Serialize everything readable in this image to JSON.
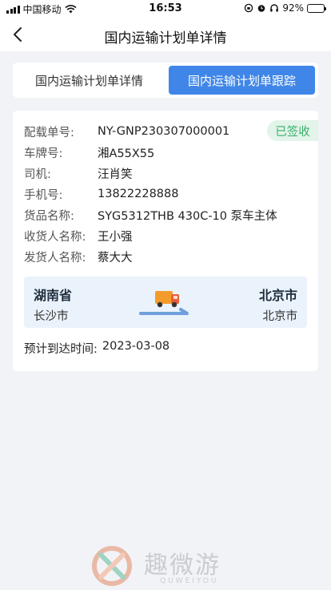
{
  "status_bar": {
    "carrier": "中国移动",
    "time": "16:53",
    "battery": "92%"
  },
  "nav": {
    "title": "国内运输计划单详情"
  },
  "tabs": [
    {
      "label": "国内运输计划单详情",
      "active": false
    },
    {
      "label": "国内运输计划单跟踪",
      "active": true
    }
  ],
  "order": {
    "status": "已签收",
    "fields": [
      {
        "label": "配载单号:",
        "value": "NY-GNP230307000001"
      },
      {
        "label": "车牌号:",
        "value": "湘A55X55"
      },
      {
        "label": "司机:",
        "value": "汪肖笑"
      },
      {
        "label": "手机号:",
        "value": "13822228888"
      },
      {
        "label": "货品名称:",
        "value": "SYG5312THB 430C-10 泵车主体"
      },
      {
        "label": "收货人名称:",
        "value": "王小强"
      },
      {
        "label": "发货人名称:",
        "value": "蔡大大"
      }
    ],
    "route": {
      "from_province": "湖南省",
      "from_city": "长沙市",
      "to_province": "北京市",
      "to_city": "北京市"
    },
    "eta_label": "预计到达时间:",
    "eta_value": "2023-03-08"
  },
  "watermark": {
    "name": "趣微游",
    "pinyin": "QUWEIYOU"
  },
  "colors": {
    "accent": "#3f86e8",
    "signed_green": "#3bb06a",
    "route_bg": "#eaf2fc",
    "page_bg": "#f2f3f7"
  }
}
